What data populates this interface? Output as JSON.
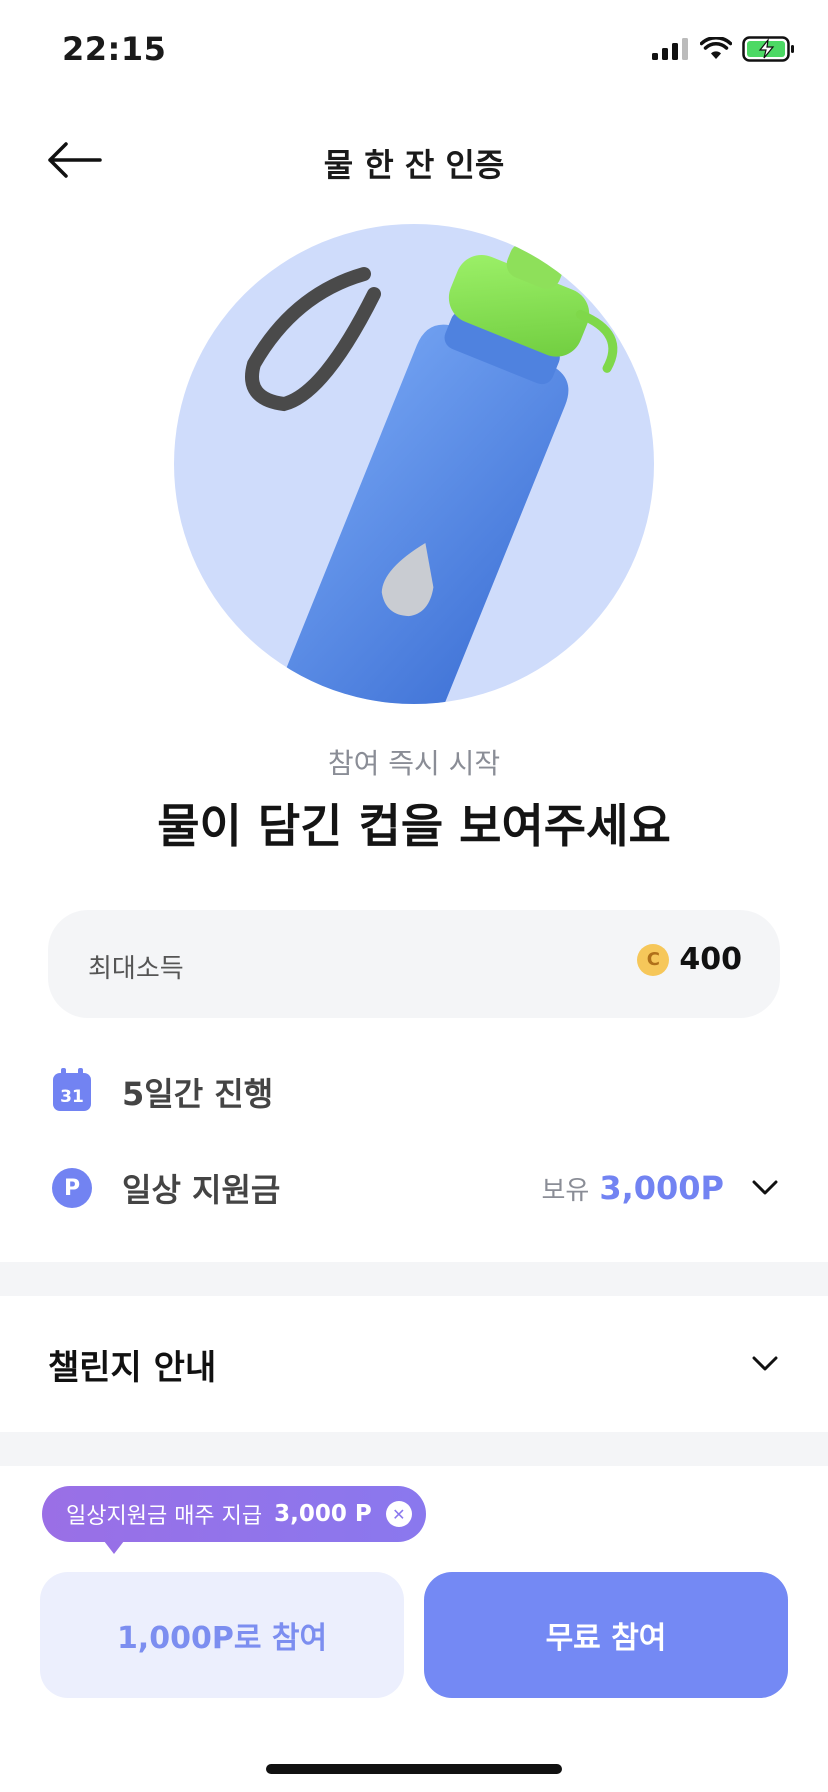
{
  "status_bar": {
    "time": "22:15"
  },
  "nav": {
    "title": "물 한 잔 인증"
  },
  "hero": {
    "image": "water-bottle-illustration"
  },
  "intro": {
    "subtitle": "참여 즉시 시작",
    "headline": "물이 담긴 컵을 보여주세요"
  },
  "reward": {
    "label": "최대소득",
    "coin_symbol": "C",
    "value": "400"
  },
  "duration": {
    "calendar_day": "31",
    "label": "5일간 진행"
  },
  "support": {
    "icon_letter": "P",
    "label": "일상 지원금",
    "hold_label": "보유",
    "hold_value": "3,000P"
  },
  "guide": {
    "title": "챌린지 안내"
  },
  "tooltip": {
    "text": "일상지원금 매주 지급",
    "amount": "3,000 P"
  },
  "buttons": {
    "point_join": "1,000P로 참여",
    "free_join": "무료 참여"
  },
  "colors": {
    "accent": "#7489f4",
    "accent_light": "#eceffd",
    "hero_bg": "#cfdcfb",
    "tooltip": "#9a6fe6"
  }
}
